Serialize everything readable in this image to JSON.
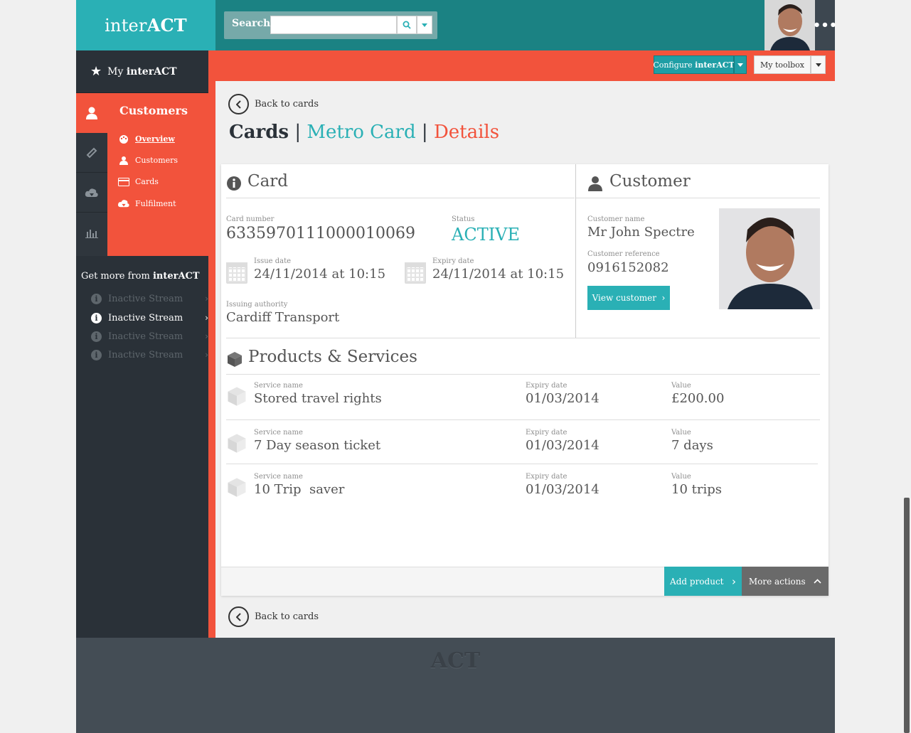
{
  "header": {
    "logo_regular": "inter",
    "logo_bold": "ACT",
    "search_label": "Search",
    "search_placeholder": "",
    "more_menu": "•••"
  },
  "toolbar": {
    "configure_label_prefix": "Configure ",
    "configure_label_bold": "interACT",
    "toolbox_label": "My toolbox"
  },
  "sidebar": {
    "my_interact_prefix": "My ",
    "my_interact_bold": "interACT",
    "section_title": "Customers",
    "sub_items": [
      {
        "label": "Overview",
        "icon": "palette-icon"
      },
      {
        "label": "Customers",
        "icon": "user-icon"
      },
      {
        "label": "Cards",
        "icon": "card-icon"
      },
      {
        "label": "Fulfilment",
        "icon": "cloud-download-icon"
      }
    ],
    "get_more_prefix": "Get more from ",
    "get_more_bold": "interACT",
    "streams": [
      {
        "label": "Inactive Stream",
        "active": false
      },
      {
        "label": "Inactive Stream",
        "active": true
      },
      {
        "label": "Inactive Stream",
        "active": false
      },
      {
        "label": "Inactive Stream",
        "active": false
      }
    ]
  },
  "main": {
    "back_label": "Back to cards",
    "breadcrumb": {
      "root": "Cards",
      "sep": "|",
      "card": "Metro Card",
      "current": "Details"
    },
    "card": {
      "title": "Card",
      "card_number_label": "Card number",
      "card_number": "6335970111000010069",
      "status_label": "Status",
      "status": "ACTIVE",
      "issue_label": "Issue date",
      "issue_value": "24/11/2014 at 10:15",
      "expiry_label": "Expiry date",
      "expiry_value": "24/11/2014 at 10:15",
      "authority_label": "Issuing authority",
      "authority_value": "Cardiff Transport"
    },
    "customer": {
      "title": "Customer",
      "name_label": "Customer name",
      "name": "Mr John Spectre",
      "ref_label": "Customer reference",
      "ref": "0916152082",
      "view_button": "View customer"
    },
    "products": {
      "title": "Products & Services",
      "col_service": "Service name",
      "col_expiry": "Expiry date",
      "col_value": "Value",
      "rows": [
        {
          "service": "Stored travel rights",
          "expiry": "01/03/2014",
          "value": "£200.00"
        },
        {
          "service": "7 Day season ticket",
          "expiry": "01/03/2014",
          "value": "7 days"
        },
        {
          "service": "10 Trip  saver",
          "expiry": "01/03/2014",
          "value": "10 trips"
        }
      ]
    },
    "actions": {
      "add_product": "Add product",
      "more_actions": "More actions"
    }
  },
  "footer": {
    "logo": "ACT"
  },
  "colors": {
    "teal": "#2ab0b5",
    "dark_teal": "#1b8283",
    "orange": "#f2533c",
    "sidebar_dark": "#2a3138",
    "footer": "#444d55"
  }
}
